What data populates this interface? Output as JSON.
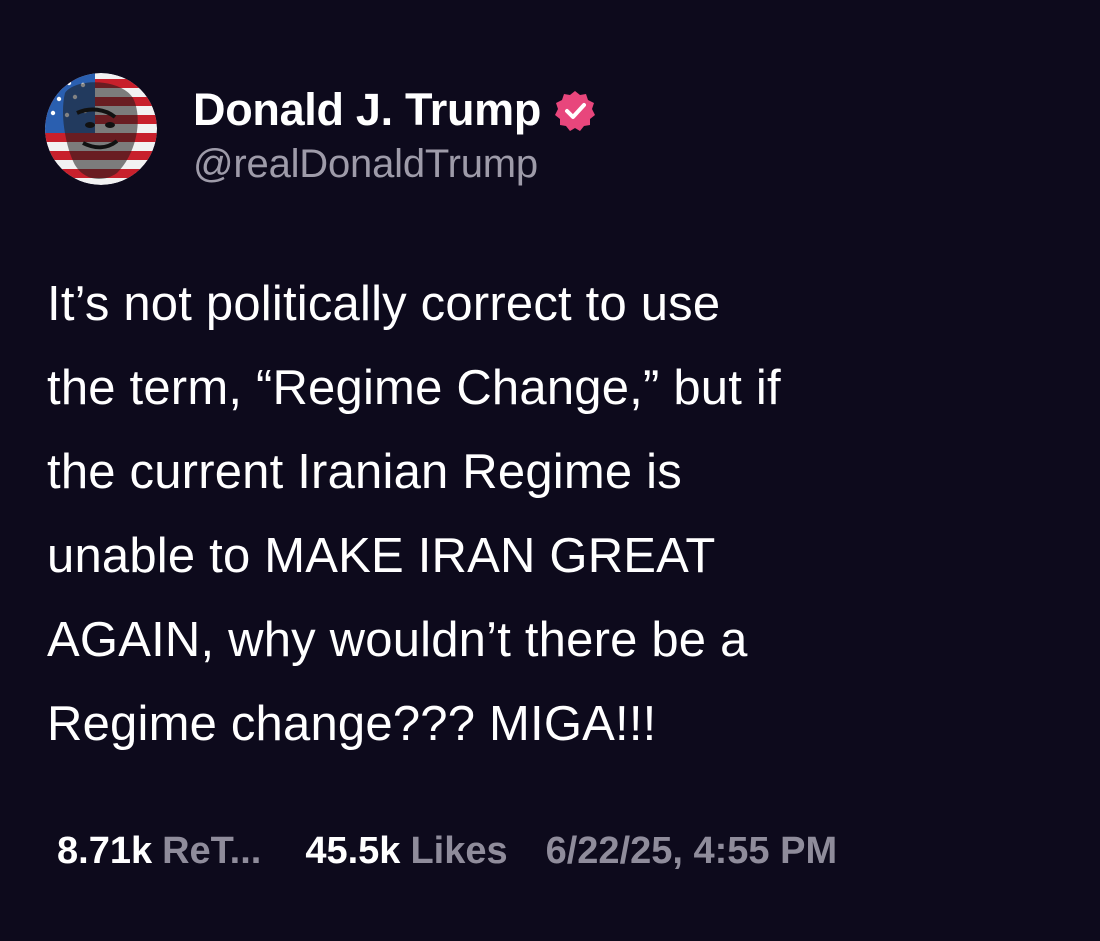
{
  "author": {
    "display_name": "Donald J. Trump",
    "handle": "@realDonaldTrump",
    "verified": true,
    "verified_badge_color": "#e8467c",
    "avatar_icon": "flag-portrait-avatar"
  },
  "post": {
    "text": "It’s not politically correct to use\nthe term, “Regime Change,” but if\nthe current Iranian Regime is\nunable to MAKE IRAN GREAT\nAGAIN, why wouldn’t there be a\nRegime change??? MIGA!!!"
  },
  "stats": {
    "retruths_count": "8.71k",
    "retruths_label": "ReT...",
    "likes_count": "45.5k",
    "likes_label": "Likes",
    "timestamp": "6/22/25, 4:55 PM"
  },
  "colors": {
    "background": "#0d0a1c",
    "text_primary": "#ffffff",
    "text_secondary": "#8f8c9b"
  }
}
